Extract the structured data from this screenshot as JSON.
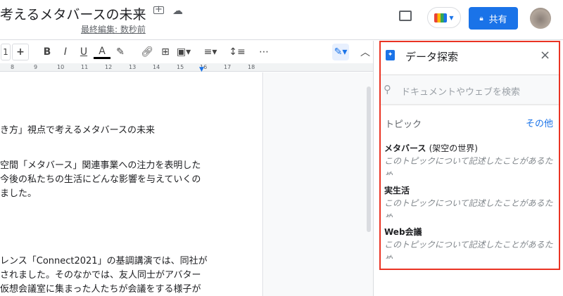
{
  "header": {
    "doc_title": "考えるメタバースの未来",
    "last_edit": "最終編集: 数秒前",
    "share_label": "共有"
  },
  "toolbar": {
    "font_size": "1",
    "plus": "+",
    "bold": "B",
    "italic": "I",
    "underline": "U",
    "text_color": "A",
    "more": "⋯"
  },
  "ruler": {
    "ticks": [
      "8",
      "9",
      "10",
      "11",
      "12",
      "13",
      "14",
      "15",
      "16",
      "17",
      "18"
    ]
  },
  "document": {
    "lines": [
      "き方」視点で考えるメタバースの未来",
      "空間「メタバース」関連事業への注力を表明した",
      "今後の私たちの生活にどんな影響を与えていくの",
      "ました。",
      "レンス「Connect2021」の基調講演では、同社が",
      "されました。そのなかでは、友人同士がアバター",
      "仮想会議室に集まった人たちが会議をする様子が"
    ]
  },
  "explore": {
    "title": "データ探索",
    "search_placeholder": "ドキュメントやウェブを検索",
    "topics_label": "トピック",
    "more_label": "その他",
    "topics": [
      {
        "name": "メタバース",
        "note": "(架空の世界)",
        "desc": "このトピックについて記述したことがあるため"
      },
      {
        "name": "実生活",
        "note": "",
        "desc": "このトピックについて記述したことがあるため"
      },
      {
        "name": "Web会議",
        "note": "",
        "desc": "このトピックについて記述したことがあるため"
      }
    ]
  },
  "colors": {
    "accent": "#1a73e8",
    "highlight_border": "#ea3323"
  }
}
